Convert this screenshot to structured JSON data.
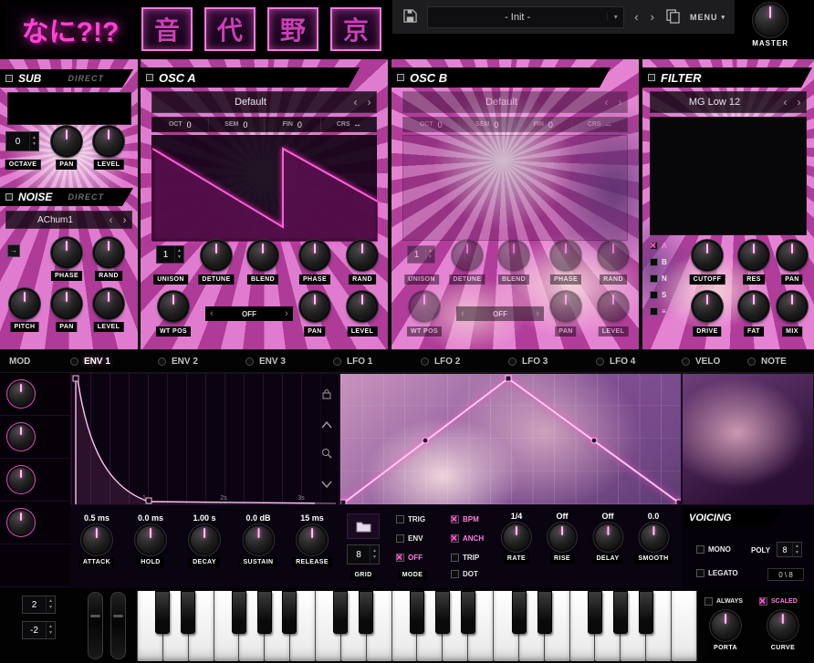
{
  "topbar": {
    "logo": "なに?!?",
    "kanji_buttons": [
      "音",
      "代",
      "野",
      "京"
    ],
    "preset_name": "- Init -",
    "menu_label": "MENU",
    "master_label": "MASTER"
  },
  "sub": {
    "title": "SUB",
    "mode": "DIRECT",
    "octave_value": "0",
    "octave_label": "OCTAVE",
    "pan_label": "PAN",
    "level_label": "LEVEL"
  },
  "noise": {
    "title": "NOISE",
    "mode": "DIRECT",
    "preset": "AChum1",
    "phase_label": "PHASE",
    "rand_label": "RAND",
    "pitch_label": "PITCH",
    "pan_label": "PAN",
    "level_label": "LEVEL"
  },
  "osc_a": {
    "title": "OSC A",
    "preset": "Default",
    "params": [
      {
        "label": "OCT",
        "value": "0"
      },
      {
        "label": "SEM",
        "value": "0"
      },
      {
        "label": "FIN",
        "value": "0"
      },
      {
        "label": "CRS",
        "value": "--"
      }
    ],
    "unison_value": "1",
    "unison_label": "UNISON",
    "detune_label": "DETUNE",
    "blend_label": "BLEND",
    "phase_label": "PHASE",
    "rand_label": "RAND",
    "wtpos_label": "WT POS",
    "morph_value": "OFF",
    "pan_label": "PAN",
    "level_label": "LEVEL"
  },
  "osc_b": {
    "title": "OSC B",
    "preset": "Default",
    "params": [
      {
        "label": "OCT",
        "value": "0"
      },
      {
        "label": "SEM",
        "value": "0"
      },
      {
        "label": "FIN",
        "value": "0"
      },
      {
        "label": "CRS",
        "value": "--"
      }
    ],
    "unison_value": "1",
    "unison_label": "UNISON",
    "detune_label": "DETUNE",
    "blend_label": "BLEND",
    "phase_label": "PHASE",
    "rand_label": "RAND",
    "wtpos_label": "WT POS",
    "morph_value": "OFF",
    "pan_label": "PAN",
    "level_label": "LEVEL"
  },
  "filter": {
    "title": "FILTER",
    "preset": "MG Low 12",
    "inputs": [
      {
        "label": "A",
        "checked": true
      },
      {
        "label": "B",
        "checked": false
      },
      {
        "label": "N",
        "checked": false
      },
      {
        "label": "S",
        "checked": false
      },
      {
        "label": "≡",
        "checked": false
      }
    ],
    "cutoff_label": "CUTOFF",
    "res_label": "RES",
    "pan_label": "PAN",
    "drive_label": "DRIVE",
    "fat_label": "FAT",
    "mix_label": "MIX"
  },
  "tabs": {
    "mod_label": "MOD",
    "items": [
      {
        "label": "ENV 1",
        "active": true
      },
      {
        "label": "ENV 2",
        "active": false
      },
      {
        "label": "ENV 3",
        "active": false
      },
      {
        "label": "LFO 1",
        "active": false
      },
      {
        "label": "LFO 2",
        "active": false
      },
      {
        "label": "LFO 3",
        "active": false
      },
      {
        "label": "LFO 4",
        "active": false
      },
      {
        "label": "VELO",
        "active": false
      },
      {
        "label": "NOTE",
        "active": false
      }
    ]
  },
  "envelope": {
    "ticks": [
      "1",
      "2s",
      "3s"
    ],
    "knobs": [
      {
        "value": "0.5 ms",
        "label": "ATTACK"
      },
      {
        "value": "0.0 ms",
        "label": "HOLD"
      },
      {
        "value": "1.00 s",
        "label": "DECAY"
      },
      {
        "value": "0.0 dB",
        "label": "SUSTAIN"
      },
      {
        "value": "15 ms",
        "label": "RELEASE"
      }
    ]
  },
  "lfo": {
    "grid_value": "8",
    "grid_label": "GRID",
    "mode_label": "MODE",
    "mode_options": [
      {
        "label": "TRIG",
        "checked": false
      },
      {
        "label": "ENV",
        "checked": false
      },
      {
        "label": "OFF",
        "checked": true
      }
    ],
    "sync_options": [
      {
        "label": "BPM",
        "checked": true
      },
      {
        "label": "ANCH",
        "checked": true
      },
      {
        "label": "TRIP",
        "checked": false
      },
      {
        "label": "DOT",
        "checked": false
      }
    ],
    "knobs": [
      {
        "value": "1/4",
        "label": "RATE"
      },
      {
        "value": "Off",
        "label": "RISE"
      },
      {
        "value": "Off",
        "label": "DELAY"
      },
      {
        "value": "0.0",
        "label": "SMOOTH"
      }
    ]
  },
  "voicing": {
    "title": "VOICING",
    "mono_label": "MONO",
    "mono_checked": false,
    "poly_label": "POLY",
    "poly_value": "8",
    "legato_label": "LEGATO",
    "legato_checked": false,
    "voices_value": "0 \\ 8"
  },
  "bottom": {
    "bend_up": "2",
    "bend_down": "-2",
    "always": {
      "label": "ALWAYS",
      "checked": false
    },
    "scaled": {
      "label": "SCALED",
      "checked": true
    },
    "porta_label": "PORTA",
    "curve_label": "CURVE"
  }
}
